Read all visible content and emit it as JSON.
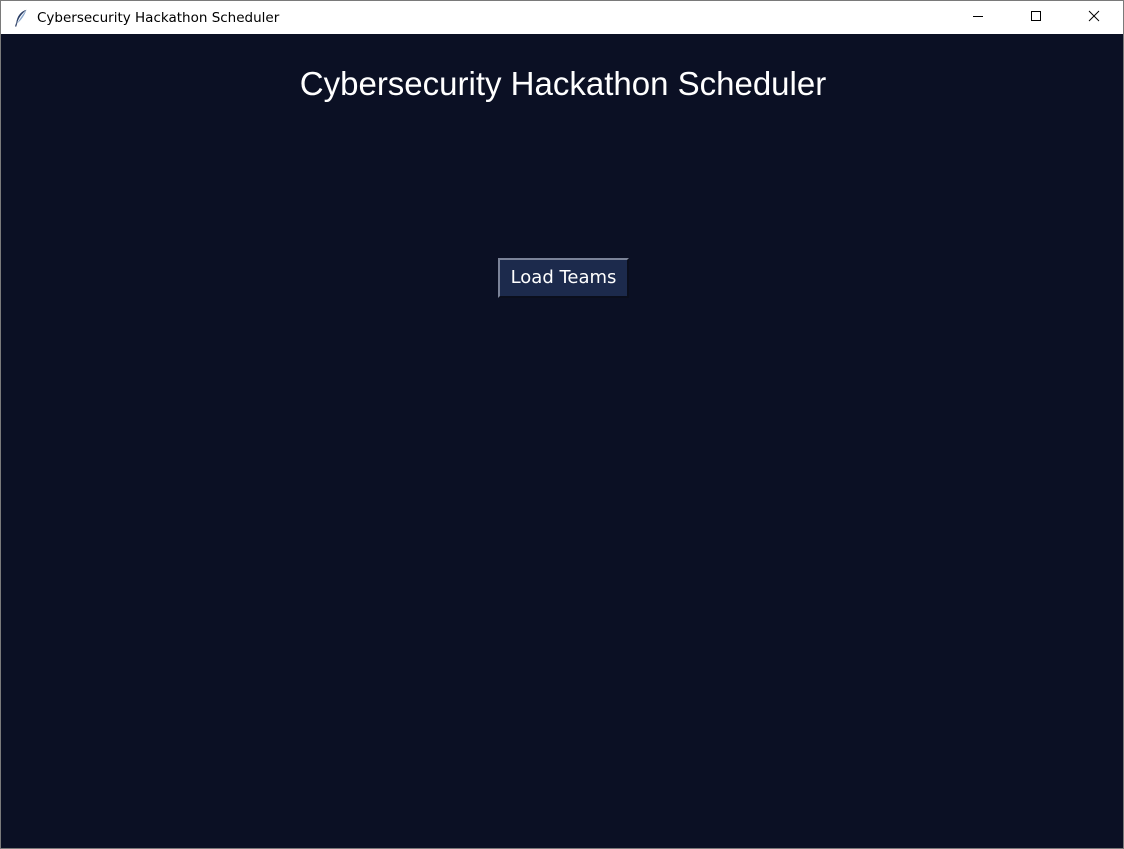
{
  "window": {
    "title": "Cybersecurity Hackathon Scheduler",
    "app_icon": "feather-icon",
    "controls": [
      "minimize-icon",
      "maximize-icon",
      "close-icon"
    ]
  },
  "main": {
    "heading": "Cybersecurity Hackathon Scheduler",
    "load_button_label": "Load Teams"
  },
  "colors": {
    "background": "#0b1024",
    "button_background": "#1c2a4c",
    "text": "#ffffff",
    "titlebar": "#ffffff"
  }
}
